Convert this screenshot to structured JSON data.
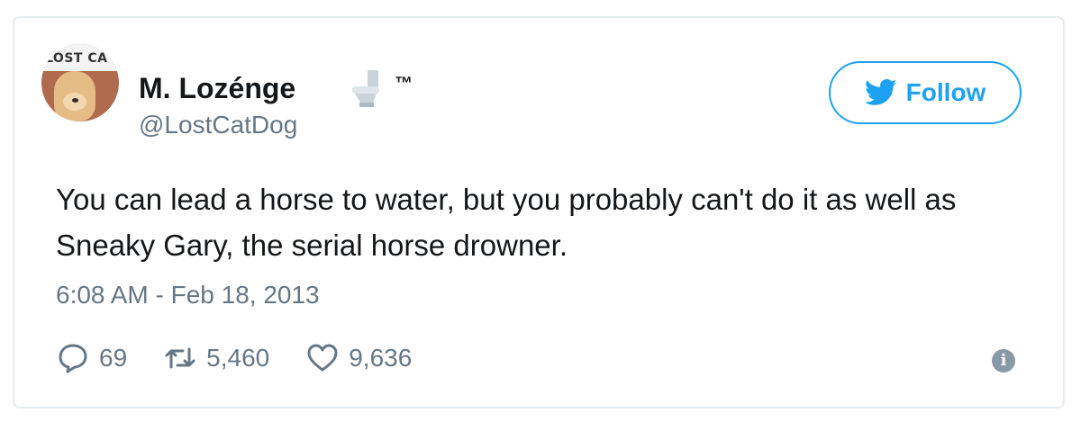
{
  "user": {
    "display_name": "M. Lozénge",
    "trademark": "™",
    "handle": "@LostCatDog",
    "avatar_text": "LOST CA",
    "name_emoji_icon": "toilet-icon"
  },
  "follow_button": {
    "label": "Follow",
    "icon": "twitter-bird-icon",
    "color": "#1da1f2"
  },
  "tweet": {
    "text": "You can lead a horse to water, but you probably can't do it as well as Sneaky Gary, the serial horse drowner.",
    "timestamp": "6:08 AM - Feb 18, 2013"
  },
  "actions": {
    "replies": "69",
    "retweets": "5,460",
    "likes": "9,636"
  }
}
